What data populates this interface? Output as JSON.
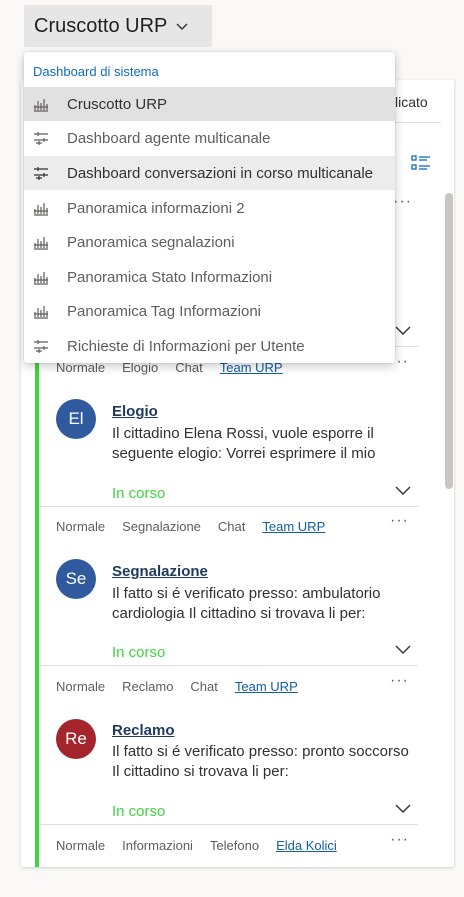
{
  "header": {
    "title": "Cruscotto URP",
    "icon": "chevron-down-icon"
  },
  "panel": {
    "partial_text": "licato",
    "view_icon": "list-view-icon",
    "more_icon": "more-dots-icon"
  },
  "dropdown": {
    "section_label": "Dashboard di sistema",
    "items": [
      {
        "label": "Cruscotto URP",
        "icon": "dashboard-grid-icon",
        "state": "selected"
      },
      {
        "label": "Dashboard agente multicanale",
        "icon": "dashboard-interactive-icon",
        "state": "normal"
      },
      {
        "label": "Dashboard conversazioni in corso multicanale",
        "icon": "dashboard-interactive-icon",
        "state": "hover"
      },
      {
        "label": "Panoramica informazioni 2",
        "icon": "dashboard-grid-icon",
        "state": "normal"
      },
      {
        "label": "Panoramica segnalazioni",
        "icon": "dashboard-grid-icon",
        "state": "normal"
      },
      {
        "label": "Panoramica Stato Informazioni",
        "icon": "dashboard-grid-icon",
        "state": "normal"
      },
      {
        "label": "Panoramica Tag Informazioni",
        "icon": "dashboard-grid-icon",
        "state": "normal"
      },
      {
        "label": "Richieste di Informazioni per Utente",
        "icon": "dashboard-interactive-icon",
        "state": "normal"
      }
    ]
  },
  "cards": [
    {
      "meta": {
        "priority": "Normale",
        "type": "Elogio",
        "channel": "Chat",
        "owner": "Team URP"
      },
      "avatar": "El",
      "avatar_color": "#2f5a9e",
      "title": "Elogio",
      "description": "Il cittadino Elena Rossi, vuole esporre il seguente elogio: Vorrei esprimere il mio",
      "status": "In corso"
    },
    {
      "meta": {
        "priority": "Normale",
        "type": "Segnalazione",
        "channel": "Chat",
        "owner": "Team URP"
      },
      "avatar": "Se",
      "avatar_color": "#2f5a9e",
      "title": "Segnalazione",
      "description": "Il fatto si é verificato presso: ambulatorio cardiologia Il cittadino si trovava li per:",
      "status": "In corso"
    },
    {
      "meta": {
        "priority": "Normale",
        "type": "Reclamo",
        "channel": "Chat",
        "owner": "Team URP"
      },
      "avatar": "Re",
      "avatar_color": "#a4262c",
      "title": "Reclamo",
      "description": "Il fatto si é verificato presso: pronto soccorso Il cittadino si trovava li per:",
      "status": "In corso"
    }
  ],
  "last_meta": {
    "priority": "Normale",
    "type": "Informazioni",
    "channel": "Telefono",
    "owner": "Elda Kolici"
  },
  "colors": {
    "accent_green": "#3fd53f",
    "link_blue": "#115ea3",
    "section_blue": "#0f6cbd"
  }
}
